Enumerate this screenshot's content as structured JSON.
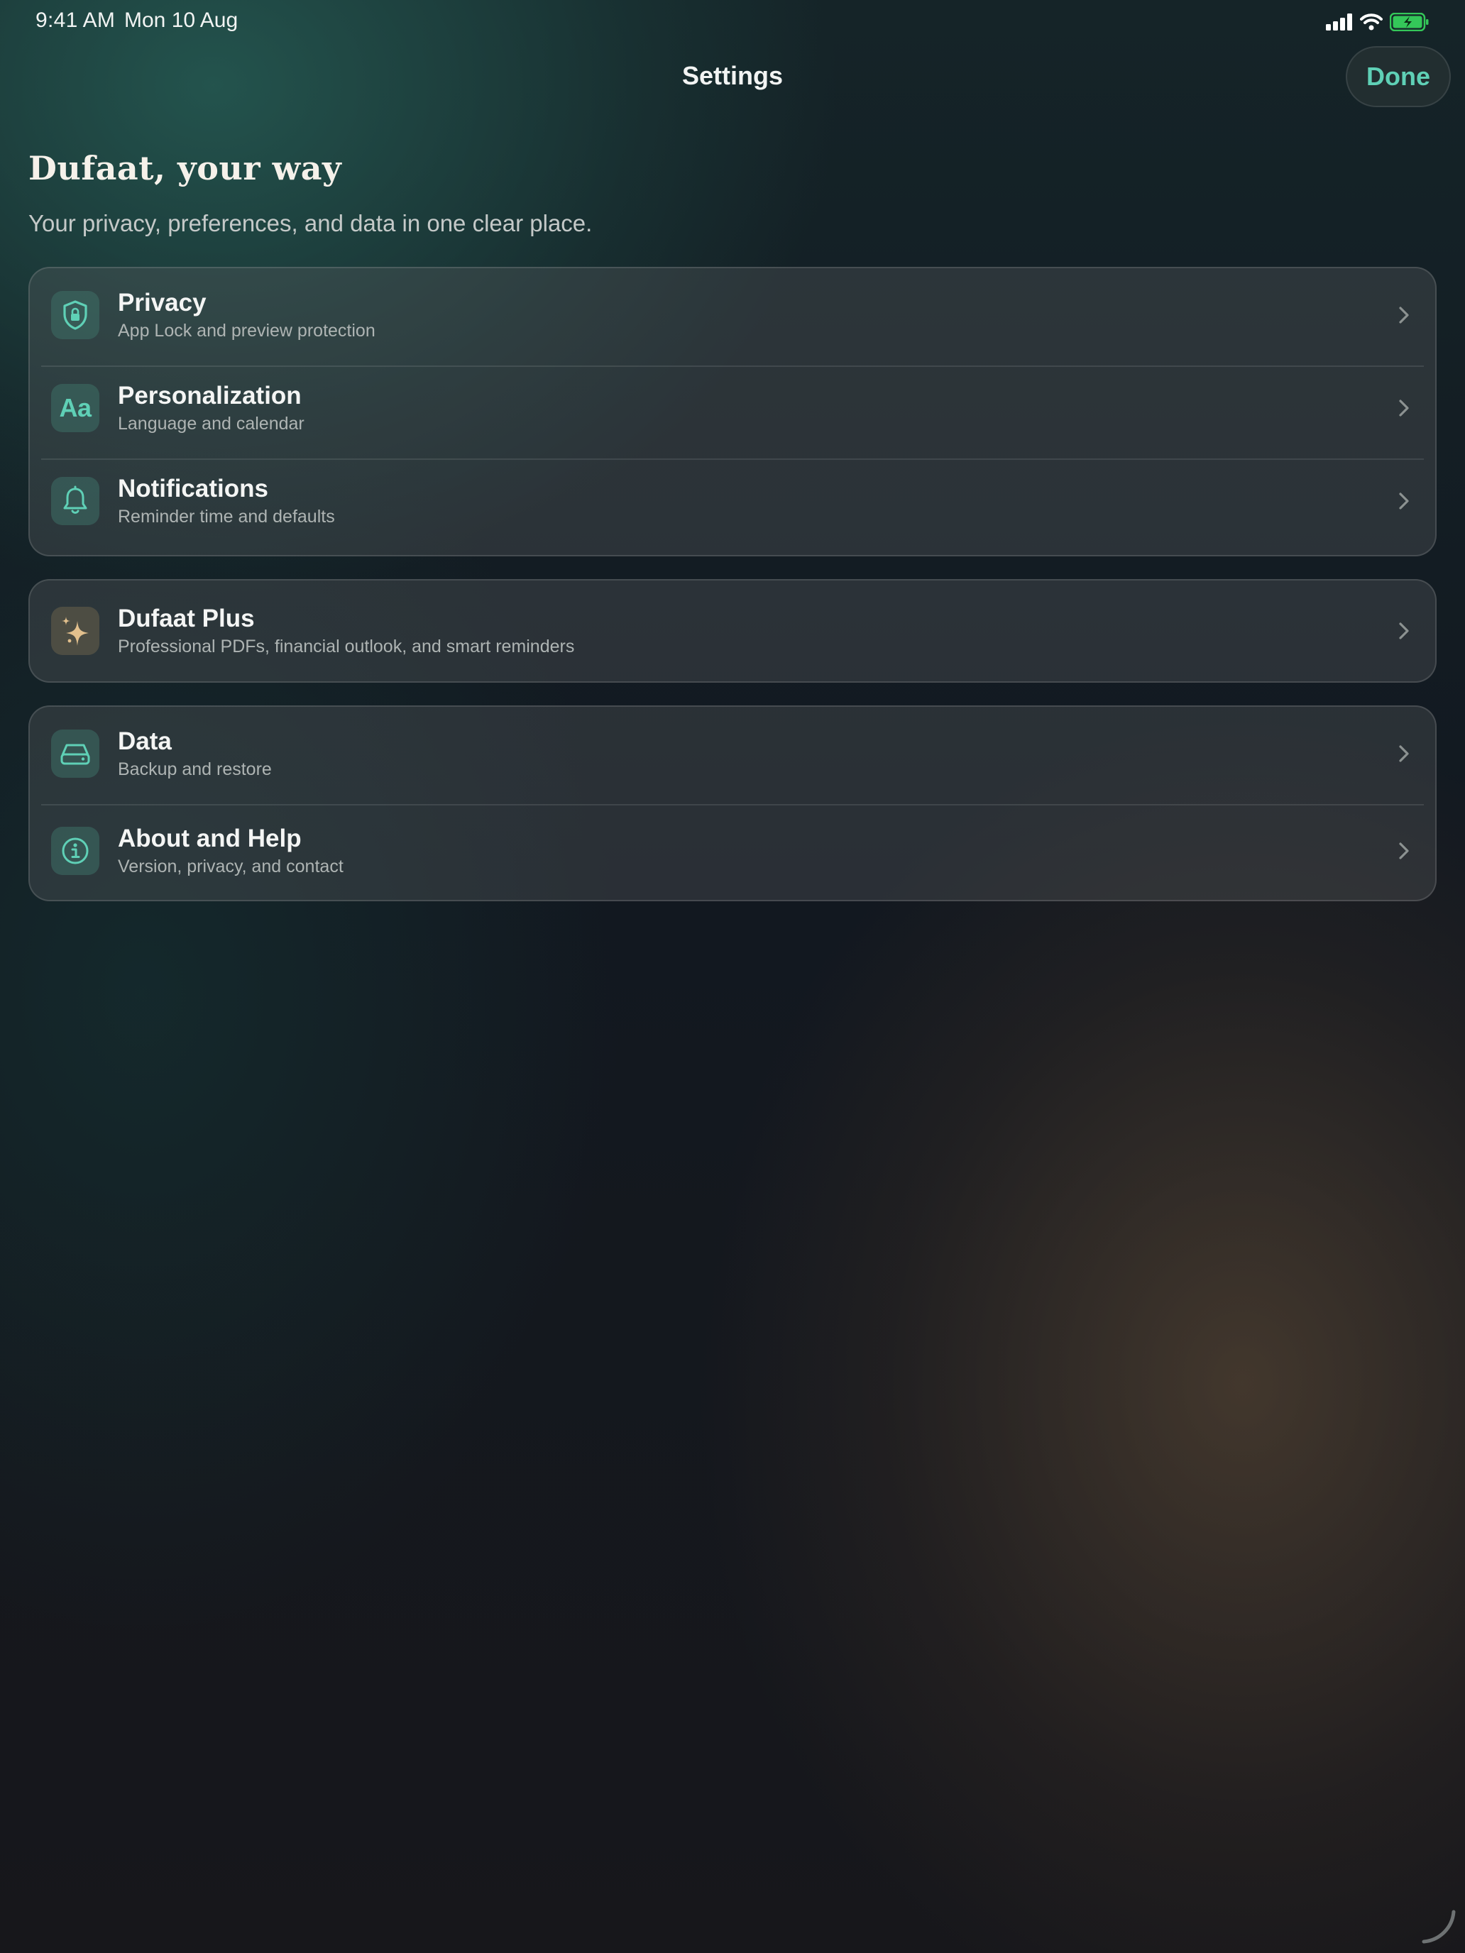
{
  "status_bar": {
    "time": "9:41 AM",
    "date": "Mon 10 Aug",
    "icons": [
      "cellular-signal-icon",
      "wifi-icon",
      "battery-charging-icon"
    ]
  },
  "nav": {
    "title": "Settings",
    "done_label": "Done"
  },
  "header": {
    "title": "Dufaat, your way",
    "subtitle": "Your privacy, preferences, and data in one clear place."
  },
  "sections": [
    {
      "items": [
        {
          "title": "Privacy",
          "subtitle": "App Lock and preview protection",
          "icon": "shield-lock-icon"
        },
        {
          "title": "Personalization",
          "subtitle": "Language and calendar",
          "icon": "text-format-icon",
          "icon_text": "Aa"
        },
        {
          "title": "Notifications",
          "subtitle": "Reminder time and defaults",
          "icon": "bell-icon"
        }
      ]
    },
    {
      "items": [
        {
          "title": "Dufaat Plus",
          "subtitle": "Professional PDFs, financial outlook, and smart reminders",
          "icon": "sparkles-icon"
        }
      ]
    },
    {
      "items": [
        {
          "title": "Data",
          "subtitle": "Backup and restore",
          "icon": "drive-icon"
        },
        {
          "title": "About and Help",
          "subtitle": "Version, privacy, and contact",
          "icon": "info-icon"
        }
      ]
    }
  ],
  "colors": {
    "accent": "#5fd0b6",
    "gold": "#e2c08d",
    "battery": "#34c759"
  }
}
